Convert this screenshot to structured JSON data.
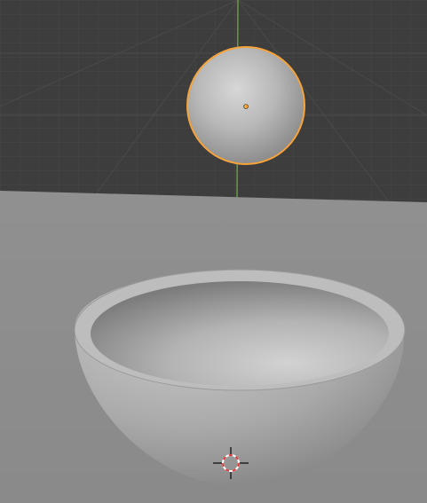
{
  "viewport": {
    "mode": "3d-viewport",
    "background_color": "#3d3d3d",
    "grid_color": "#4a4a4a",
    "y_axis_color": "#6a9a40",
    "floor_color": "#8f8f8f"
  },
  "objects": [
    {
      "name": "sphere",
      "selected": true,
      "selection_color": "#f5a33a",
      "origin_color": "#f5a33a"
    },
    {
      "name": "bowl",
      "selected": false
    }
  ],
  "cursor": {
    "icon": "3d-cursor-icon",
    "colors": [
      "#e23a3a",
      "#ffffff"
    ]
  }
}
